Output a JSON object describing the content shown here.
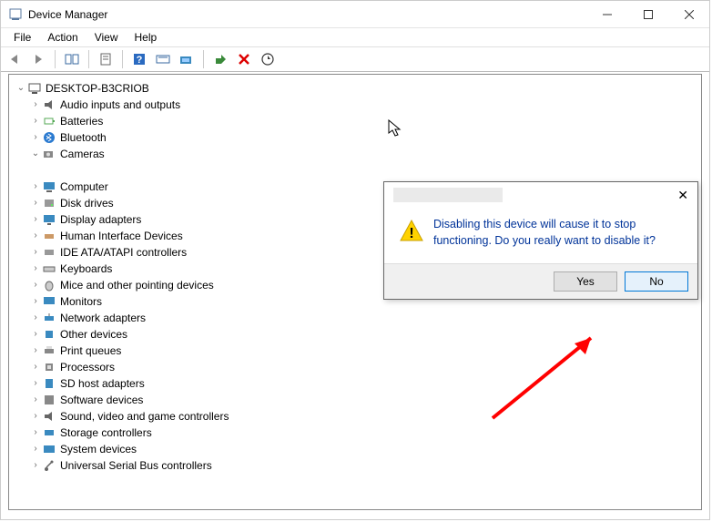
{
  "window": {
    "title": "Device Manager"
  },
  "menubar": {
    "file": "File",
    "action": "Action",
    "view": "View",
    "help": "Help"
  },
  "tree": {
    "root": "DESKTOP-B3CRIOB",
    "items": [
      "Audio inputs and outputs",
      "Batteries",
      "Bluetooth",
      "Cameras",
      "",
      "Computer",
      "Disk drives",
      "Display adapters",
      "Human Interface Devices",
      "IDE ATA/ATAPI controllers",
      "Keyboards",
      "Mice and other pointing devices",
      "Monitors",
      "Network adapters",
      "Other devices",
      "Print queues",
      "Processors",
      "SD host adapters",
      "Software devices",
      "Sound, video and game controllers",
      "Storage controllers",
      "System devices",
      "Universal Serial Bus controllers"
    ]
  },
  "dialog": {
    "message": "Disabling this device will cause it to stop functioning. Do you really want to disable it?",
    "yes": "Yes",
    "no": "No"
  }
}
